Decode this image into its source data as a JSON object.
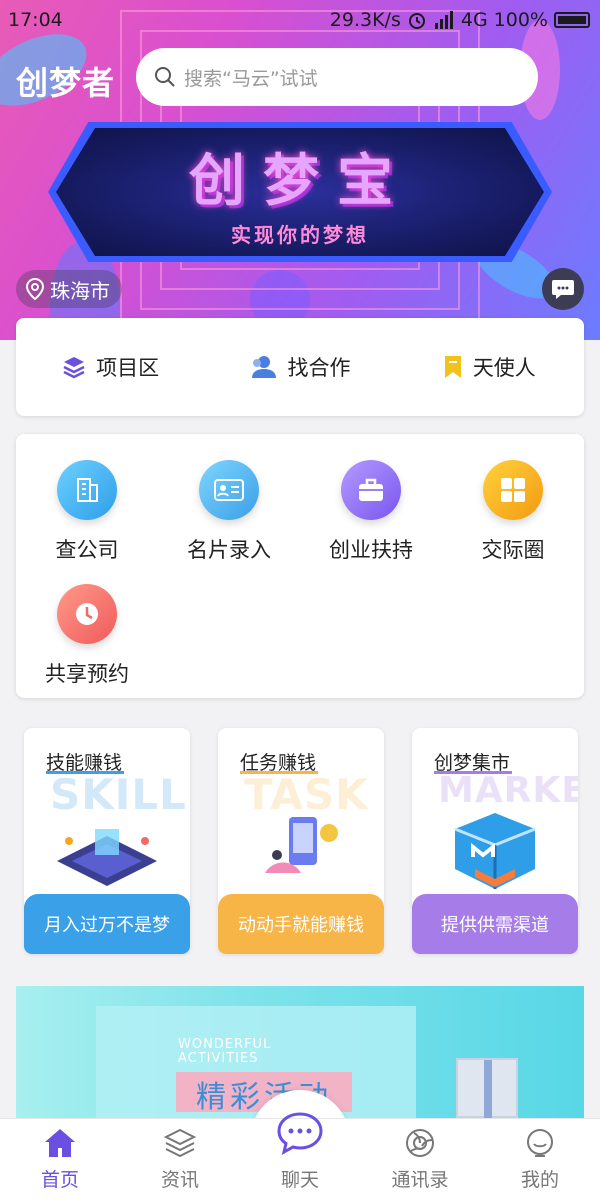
{
  "status_bar": {
    "time": "17:04",
    "network_speed": "29.3K/s",
    "signal_type": "4G",
    "battery": "100%"
  },
  "header": {
    "logo": "创梦者",
    "search_placeholder": "搜索“马云”试试",
    "banner_title": "创梦宝",
    "banner_subtitle": "实现你的梦想",
    "location": "珠海市"
  },
  "quick_nav": [
    {
      "label": "项目区",
      "icon": "layers-icon",
      "color": "#6a4fe0"
    },
    {
      "label": "找合作",
      "icon": "users-icon",
      "color": "#4a7fe0"
    },
    {
      "label": "天使人",
      "icon": "bookmark-icon",
      "color": "#f2c21c"
    }
  ],
  "services": [
    {
      "label": "查公司",
      "icon": "building-icon",
      "color": "#48b8f0"
    },
    {
      "label": "名片录入",
      "icon": "id-card-icon",
      "color": "#4bb0ef"
    },
    {
      "label": "创业扶持",
      "icon": "briefcase-icon",
      "color": "#8a6cf0"
    },
    {
      "label": "交际圈",
      "icon": "grid-icon",
      "color": "#f5a623"
    },
    {
      "label": "共享预约",
      "icon": "clock-icon",
      "color": "#f06a6a"
    }
  ],
  "promos": [
    {
      "title": "技能赚钱",
      "ghost": "SKILL",
      "footer": "月入过万不是梦",
      "color": "#3aa0e8"
    },
    {
      "title": "任务赚钱",
      "ghost": "TASK",
      "footer": "动动手就能赚钱",
      "color": "#f7b547"
    },
    {
      "title": "创梦集市",
      "ghost": "MARKET",
      "footer": "提供供需渠道",
      "color": "#a57ce8"
    }
  ],
  "activity": {
    "en_line1": "WONDERFUL",
    "en_line2": "ACTIVITIES",
    "cn": "精彩活动"
  },
  "tabs": [
    {
      "label": "首页",
      "icon": "home-icon",
      "active": true
    },
    {
      "label": "资讯",
      "icon": "stack-icon",
      "active": false
    },
    {
      "label": "聊天",
      "icon": "chat-icon",
      "active": false
    },
    {
      "label": "通讯录",
      "icon": "contacts-icon",
      "active": false
    },
    {
      "label": "我的",
      "icon": "profile-icon",
      "active": false
    }
  ],
  "colors": {
    "accent": "#6a4fe0",
    "tab_inactive": "#777777"
  }
}
